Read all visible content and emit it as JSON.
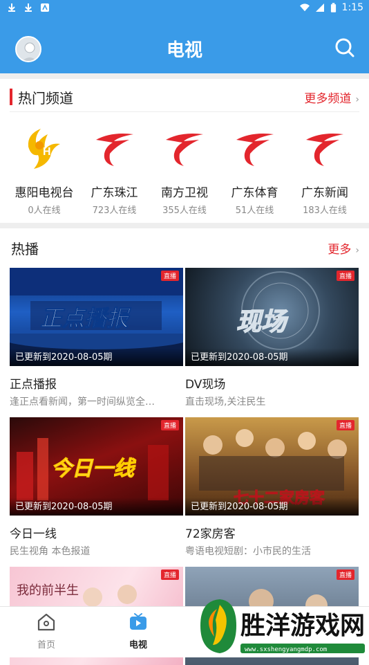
{
  "status_bar": {
    "time": "1:15"
  },
  "header": {
    "title": "电视"
  },
  "hot_channels": {
    "title": "热门频道",
    "more_label": "更多频道",
    "channels": [
      {
        "name": "惠阳电视台",
        "online": "0人在线",
        "logo": "huiyang-logo"
      },
      {
        "name": "广东珠江",
        "online": "723人在线",
        "logo": "guangdong-tv-logo"
      },
      {
        "name": "南方卫视",
        "online": "355人在线",
        "logo": "guangdong-tv-logo"
      },
      {
        "name": "广东体育",
        "online": "51人在线",
        "logo": "guangdong-tv-logo"
      },
      {
        "name": "广东新闻",
        "online": "183人在线",
        "logo": "guangdong-tv-logo"
      }
    ]
  },
  "hot_shows": {
    "title": "热播",
    "more_label": "更多",
    "items": [
      {
        "title": "正点播报",
        "desc": "逢正点看新闻，第一时间纵览全…",
        "update": "已更新到2020-08-05期",
        "badge": "直播",
        "thumb_text": "正点播报"
      },
      {
        "title": "DV现场",
        "desc": "直击现场,关注民生",
        "update": "已更新到2020-08-05期",
        "badge": "直播",
        "thumb_text": "现场"
      },
      {
        "title": "今日一线",
        "desc": "民生视角 本色报道",
        "update": "已更新到2020-08-05期",
        "badge": "直播",
        "thumb_text": "今日一线"
      },
      {
        "title": "72家房客",
        "desc": "粤语电视短剧：小市民的生活",
        "update": "已更新到2020-08-05期",
        "badge": "直播",
        "thumb_text": "七十二家房客"
      },
      {
        "title": "",
        "desc": "",
        "update": "",
        "badge": "直播",
        "thumb_text": "我的前半生"
      },
      {
        "title": "",
        "desc": "",
        "update": "",
        "badge": "直播",
        "thumb_text": ""
      }
    ]
  },
  "bottom_nav": {
    "items": [
      {
        "label": "首页",
        "icon": "home-icon",
        "active": false
      },
      {
        "label": "电视",
        "icon": "tv-icon",
        "active": true
      }
    ]
  },
  "watermark": {
    "text": "胜洋游戏网",
    "url": "www.sxshengyangmdp.com"
  },
  "colors": {
    "primary": "#3a9be8",
    "accent_red": "#e3262d"
  }
}
